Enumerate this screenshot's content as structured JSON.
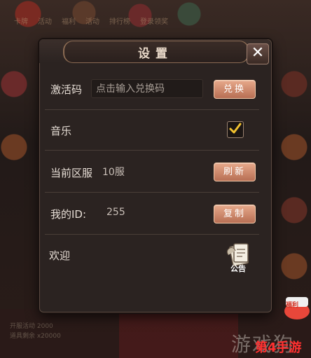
{
  "background": {
    "top_labels": [
      "卡牌",
      "活动",
      "福利",
      "活动",
      "排行榜",
      "登录领奖"
    ],
    "bottom_text": [
      "开服活动 2000",
      "道具剩余 x20000"
    ]
  },
  "dialog": {
    "title": "设置",
    "close_symbol": "✕"
  },
  "activation": {
    "label": "激活码",
    "input_value": "",
    "input_placeholder": "点击输入兑换码",
    "button_label": "兑换"
  },
  "music": {
    "label": "音乐",
    "checked": true
  },
  "server": {
    "label": "当前区服",
    "value": "10服",
    "button_label": "刷新"
  },
  "user_id": {
    "label": "我的ID:",
    "value": "255",
    "button_label": "复制"
  },
  "welcome": {
    "label": "欢迎",
    "notice_label": "公告"
  },
  "promo": {
    "badge_text": "福利",
    "watermark": "游戏狗",
    "watermark_red": "第4手游"
  },
  "colors": {
    "panel_bg": "#2b2321",
    "button_accent": "#c98063",
    "checkbox_tick": "#f2c230"
  }
}
